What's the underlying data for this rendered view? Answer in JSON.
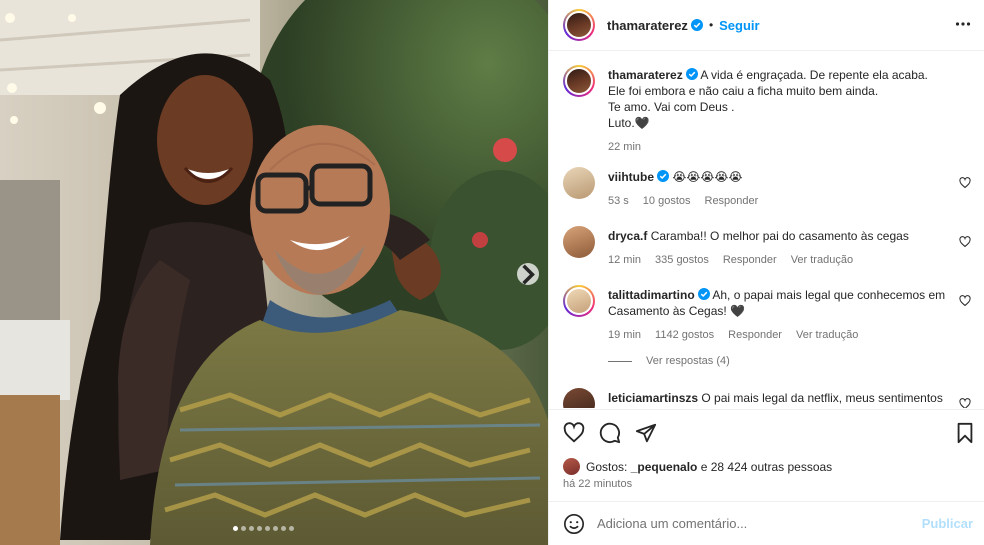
{
  "post": {
    "author": "thamaraterez",
    "follow_label": "Seguir",
    "separator": "•",
    "caption_lines": [
      "A vida é engraçada. De repente ela acaba.",
      "Ele foi embora e não caiu a ficha muito bem ainda.",
      "Te amo. Vai com Deus .",
      "Luto.🖤"
    ],
    "caption_time": "22 min"
  },
  "comments": [
    {
      "user": "viihtube",
      "verified": true,
      "text": "😭😭😭😭😭",
      "time": "53 s",
      "likes": "10 gostos",
      "reply": "Responder",
      "translate": ""
    },
    {
      "user": "dryca.f",
      "verified": false,
      "text": "Caramba!! O melhor pai do casamento às cegas",
      "time": "12 min",
      "likes": "335 gostos",
      "reply": "Responder",
      "translate": "Ver tradução"
    },
    {
      "user": "talittadimartino",
      "verified": true,
      "text": "Ah, o papai mais legal que conhecemos em Casamento às Cegas! 🖤",
      "time": "19 min",
      "likes": "1142 gostos",
      "reply": "Responder",
      "translate": "Ver tradução"
    },
    {
      "user": "leticiamartinszs",
      "verified": false,
      "text": "O pai mais legal da netflix, meus sentimentos",
      "time": "",
      "likes": "",
      "reply": "",
      "translate": ""
    }
  ],
  "replies_label": "Ver respostas (4)",
  "likes_summary": {
    "prefix": "Gostos:",
    "user": "_pequenalo",
    "suffix": "e 28 424 outras pessoas"
  },
  "post_time": "há 22 minutos",
  "comment_box": {
    "placeholder": "Adiciona um comentário...",
    "post_label": "Publicar"
  },
  "carousel": {
    "total": 8,
    "current": 1
  },
  "colors": {
    "link": "#0095f6",
    "verified": "#0095f6",
    "muted": "#737373",
    "post_disabled": "#b2dffc"
  }
}
